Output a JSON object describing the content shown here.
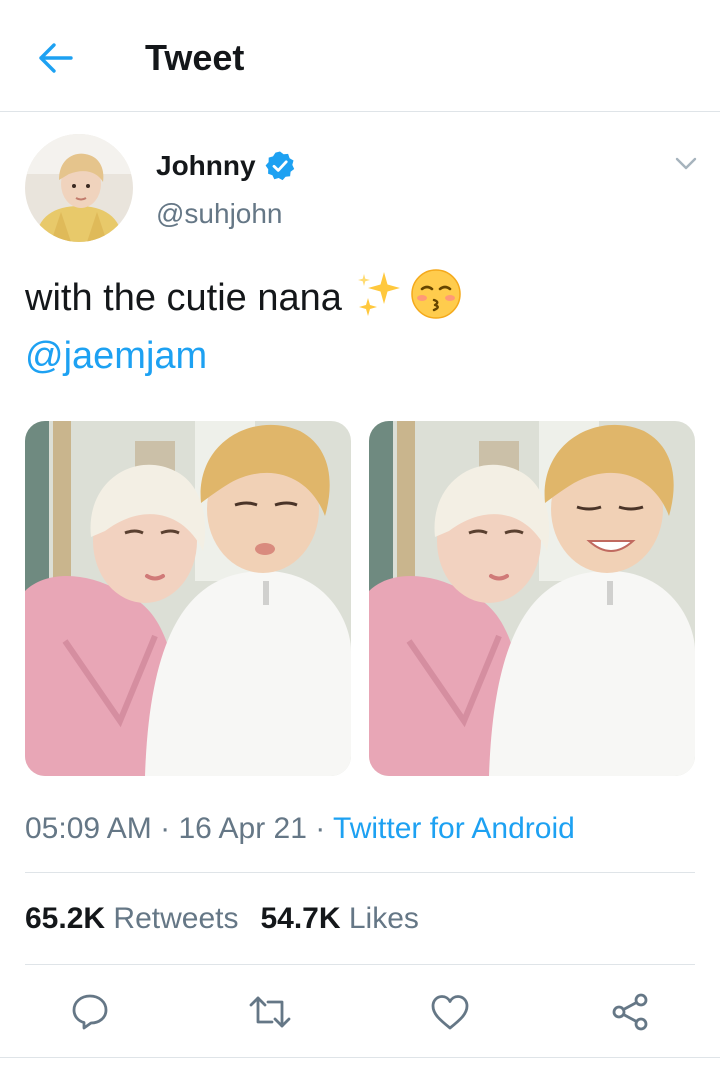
{
  "header": {
    "title": "Tweet",
    "back_icon": "arrow-left-icon"
  },
  "colors": {
    "accent": "#1da1f2",
    "secondary_text": "#657786",
    "divider": "#dfe4e8"
  },
  "author": {
    "display_name": "Johnny",
    "handle": "@suhjohn",
    "verified": true,
    "verified_icon": "verified-badge-icon",
    "menu_icon": "chevron-down-icon"
  },
  "tweet": {
    "text": "with the cutie nana",
    "emojis": [
      "✨",
      "😚"
    ],
    "mention": "@jaemjam",
    "photo_count": 2
  },
  "meta": {
    "time": "05:09 AM",
    "date": "16 Apr 21",
    "separator": "·",
    "source": "Twitter for Android"
  },
  "stats": {
    "retweets_count": "65.2K",
    "retweets_label": "Retweets",
    "likes_count": "54.7K",
    "likes_label": "Likes"
  },
  "actions": [
    {
      "name": "reply",
      "icon": "reply-icon"
    },
    {
      "name": "retweet",
      "icon": "retweet-icon"
    },
    {
      "name": "like",
      "icon": "heart-icon"
    },
    {
      "name": "share",
      "icon": "share-icon"
    }
  ]
}
